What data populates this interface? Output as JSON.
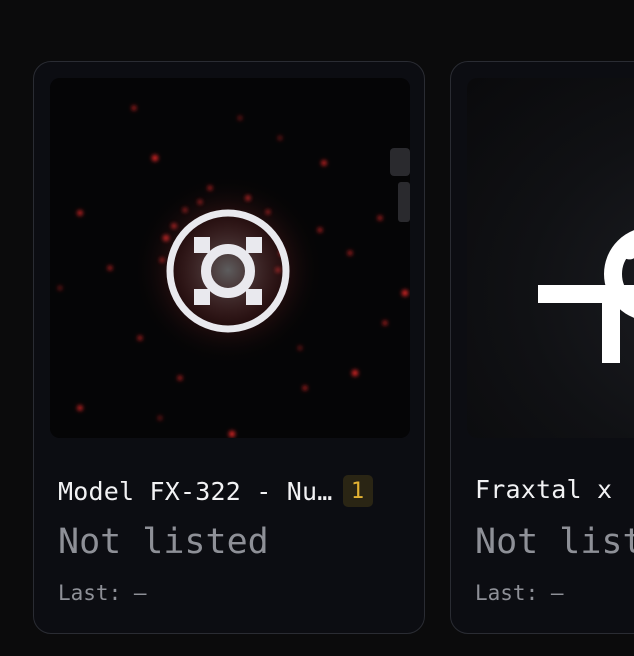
{
  "cards": [
    {
      "title": "Model FX-322 - Nu…",
      "badge": "1",
      "price": "Not listed",
      "last_label": "Last:",
      "last_value": "—",
      "image_icon": "frax-symbol-icon",
      "badge_color": "#e3b232"
    },
    {
      "title": "Fraxtal x",
      "price": "Not list",
      "last_label": "Last:",
      "last_value": "—",
      "image_icon": "fraxtal-logo-icon"
    }
  ]
}
